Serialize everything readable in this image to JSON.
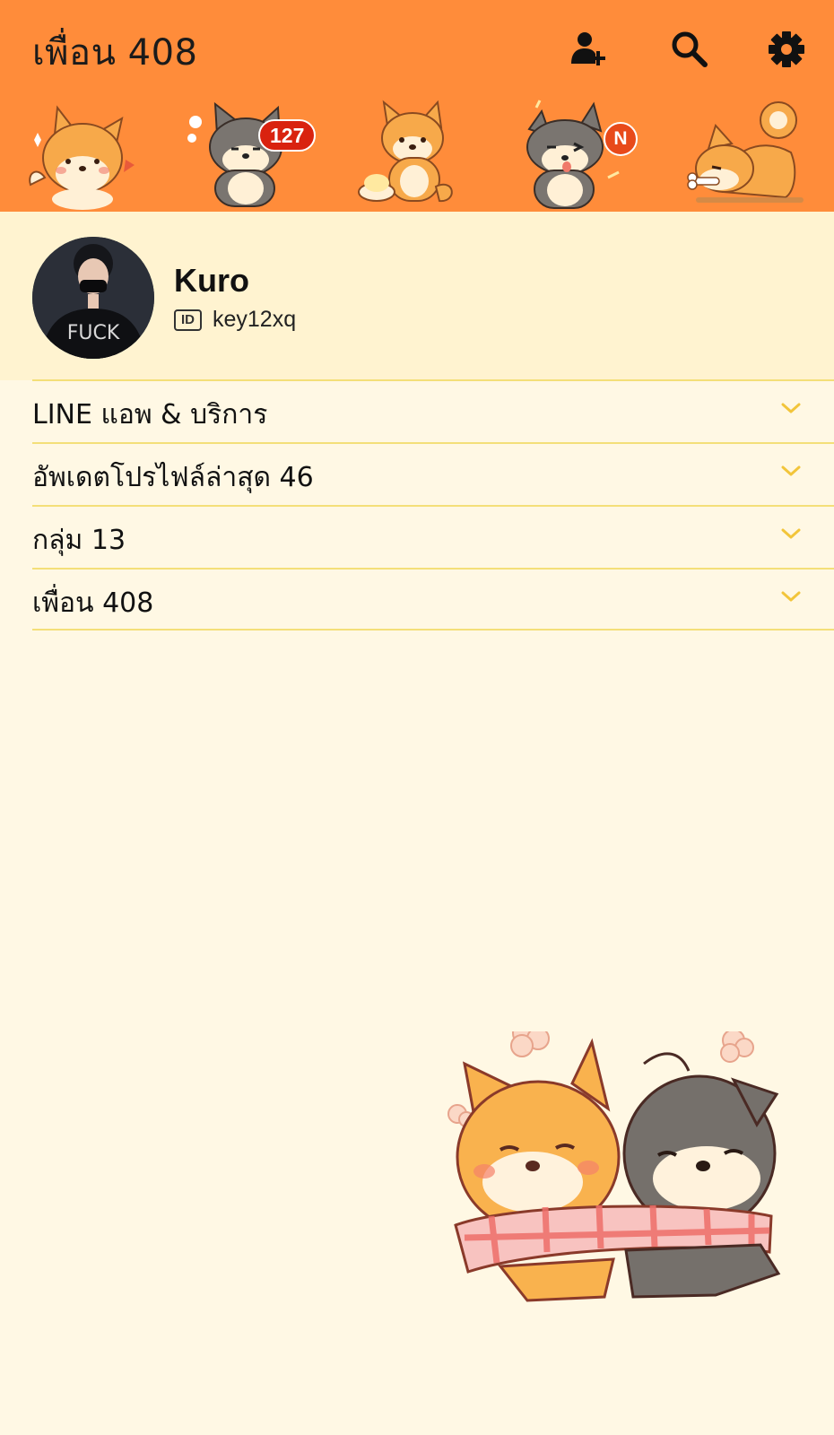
{
  "header": {
    "title": "เพื่อน 408",
    "icons": [
      "add-friend-icon",
      "search-icon",
      "gear-icon"
    ],
    "background": "#FF8C3A"
  },
  "tabs": {
    "items": [
      {
        "name": "shiba-sticker-1"
      },
      {
        "name": "gray-dog-sticker",
        "badge": "127"
      },
      {
        "name": "shiba-bowl-sticker"
      },
      {
        "name": "gray-dog-wink-sticker",
        "badge": "N"
      },
      {
        "name": "shiba-bone-sticker"
      }
    ]
  },
  "profile": {
    "name": "Kuro",
    "id_label": "ID",
    "id": "key12xq",
    "avatar_text": "FUCK"
  },
  "sections": [
    {
      "label": "LINE แอพ & บริการ"
    },
    {
      "label": "อัพเดตโปรไฟล์ล่าสุด 46"
    },
    {
      "label": "กลุ่ม 13"
    },
    {
      "label": "เพื่อน 408"
    }
  ],
  "colors": {
    "accent": "#FF8C3A",
    "background": "#FFF8E4",
    "profile_bg": "#FFF3D0",
    "divider": "#F4DF78",
    "chevron": "#F2C53A",
    "badge": "#D9220F"
  }
}
